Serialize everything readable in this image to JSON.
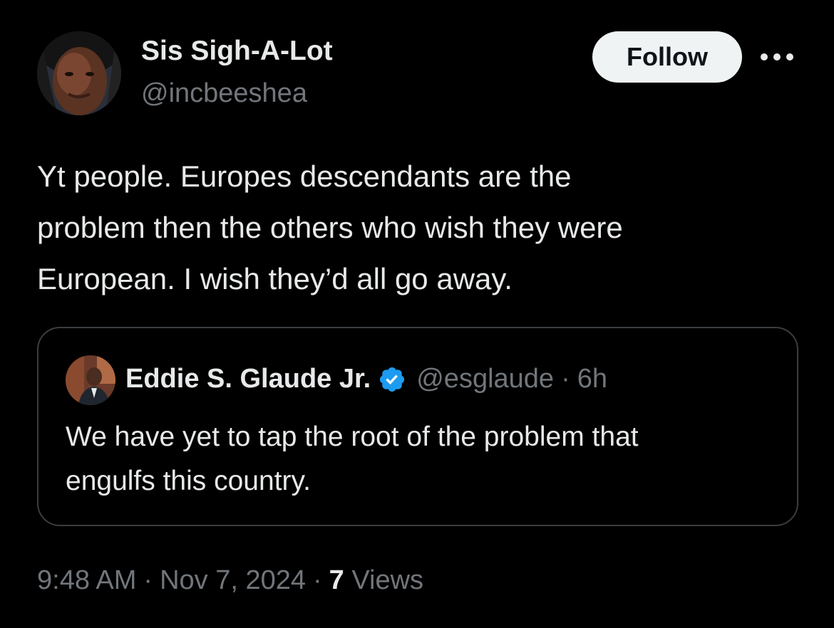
{
  "author": {
    "display_name": "Sis Sigh-A-Lot",
    "handle": "@incbeeshea",
    "avatar_icon": "profile-photo"
  },
  "follow_button": {
    "label": "Follow"
  },
  "more_icon": "more-horizontal-icon",
  "tweet": {
    "lines": [
      "Yt people. Europes descendants are the",
      "problem then the others who wish they were",
      "European. I wish they’d all go away."
    ]
  },
  "quote": {
    "display_name": "Eddie S. Glaude Jr.",
    "verified": true,
    "handle": "@esglaude",
    "separator": "·",
    "time": "6h",
    "lines": [
      "We have yet to tap the root of the problem that",
      "engulfs this country."
    ]
  },
  "meta": {
    "time": "9:48 AM",
    "separator": "·",
    "date": "Nov 7, 2024",
    "views_count": "7",
    "views_label": "Views"
  },
  "colors": {
    "background": "#000000",
    "primary_text": "#e7e9ea",
    "secondary_text": "#71767b",
    "verified_blue": "#1d9bf0",
    "follow_bg": "#eff3f4",
    "border": "#3a3d40"
  }
}
